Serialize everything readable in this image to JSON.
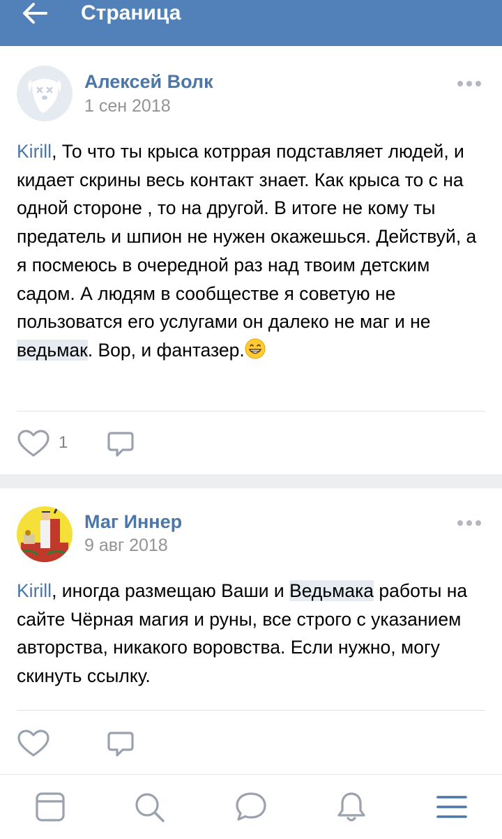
{
  "header": {
    "title": "Страница",
    "bg_color": "#5181b8",
    "back_icon": "arrow-left-icon"
  },
  "posts": [
    {
      "author": "Алексей Волк",
      "date": "1 сен 2018",
      "avatar": "deactivated-dog-avatar",
      "text": {
        "mention": "Kirill",
        "part1": ", То что ты крыса котррая подставляет людей, и кидает скрины весь контакт знает. Как крыса то с на одной стороне , то на другой. В итоге не кому ты предатель и шпион не нужен окажешься. Действуй, а я посмеюсь в очередной раз над твоим детским садом. А людям в сообществе я советую не пользоватся его услугами он далеко не маг и не ",
        "highlight": "ведьмак",
        "part2": ". Вор, и фантазер."
      },
      "emoji": "grinning-face-emoji",
      "likes": "1"
    },
    {
      "author": "Маг Иннер",
      "date": "9 авг 2018",
      "avatar": "tarot-magician-avatar",
      "text": {
        "mention": "Kirill",
        "part1": ", иногда размещаю Ваши и ",
        "highlight": "Ведьмака",
        "part2": " работы на сайте Чёрная магия и руны, все строго с указанием авторства, никакого воровства. Если нужно, могу скинуть ссылку."
      }
    }
  ],
  "tabbar": {
    "tabs": [
      "news-feed-icon",
      "search-icon",
      "messages-icon",
      "notifications-icon",
      "menu-icon"
    ]
  },
  "colors": {
    "link": "#4a76a8",
    "highlight": "#e5ebf1",
    "icon_gray": "#99a2ad",
    "tab_active": "#4a76a8"
  }
}
